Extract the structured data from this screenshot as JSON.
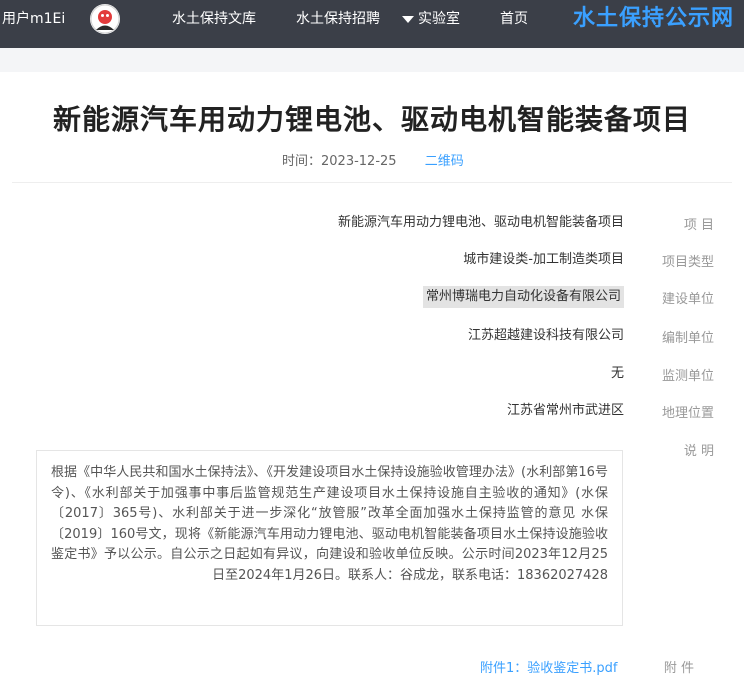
{
  "nav": {
    "brand": "水土保持公示网",
    "items": [
      "首页",
      "实验室",
      "水土保持招聘",
      "水土保持文库"
    ],
    "username": "用户m1Ei"
  },
  "article": {
    "title": "新能源汽车用动力锂电池、驱动电机智能装备项目",
    "time": "时间：2023-12-25",
    "views": "二维码"
  },
  "fields": [
    {
      "label": "项  目",
      "value": "新能源汽车用动力锂电池、驱动电机智能装备项目"
    },
    {
      "label": "项目类型",
      "value": "城市建设类-加工制造类项目"
    },
    {
      "label": "建设单位",
      "value": "常州博瑞电力自动化设备有限公司"
    },
    {
      "label": "编制单位",
      "value": "江苏超越建设科技有限公司"
    },
    {
      "label": "监测单位",
      "value": "无"
    },
    {
      "label": "地理位置",
      "value": "江苏省常州市武进区"
    },
    {
      "label": "说  明",
      "value": ""
    }
  ],
  "description": "根据《中华人民共和国水土保持法》、《开发建设项目水土保持设施验收管理办法》(水利部第16号令)、《水利部关于加强事中事后监管规范生产建设项目水土保持设施自主验收的通知》(水保〔2017〕365号)、水利部关于进一步深化“放管服”改革全面加强水土保持监管的意见 水保〔2019〕160号文，现将《新能源汽车用动力锂电池、驱动电机智能装备项目水土保持设施验收鉴定书》予以公示。自公示之日起如有异议，向建设和验收单位反映。公示时间2023年12月25日至2024年1月26日。联系人：谷成龙，联系电话：18362027428",
  "attachment": {
    "label": "附  件",
    "link": "附件1：验收鉴定书.pdf"
  },
  "colors": {
    "navbar": "#3b3f48",
    "brand": "#3aa0ff",
    "link": "#3aa0ff"
  }
}
